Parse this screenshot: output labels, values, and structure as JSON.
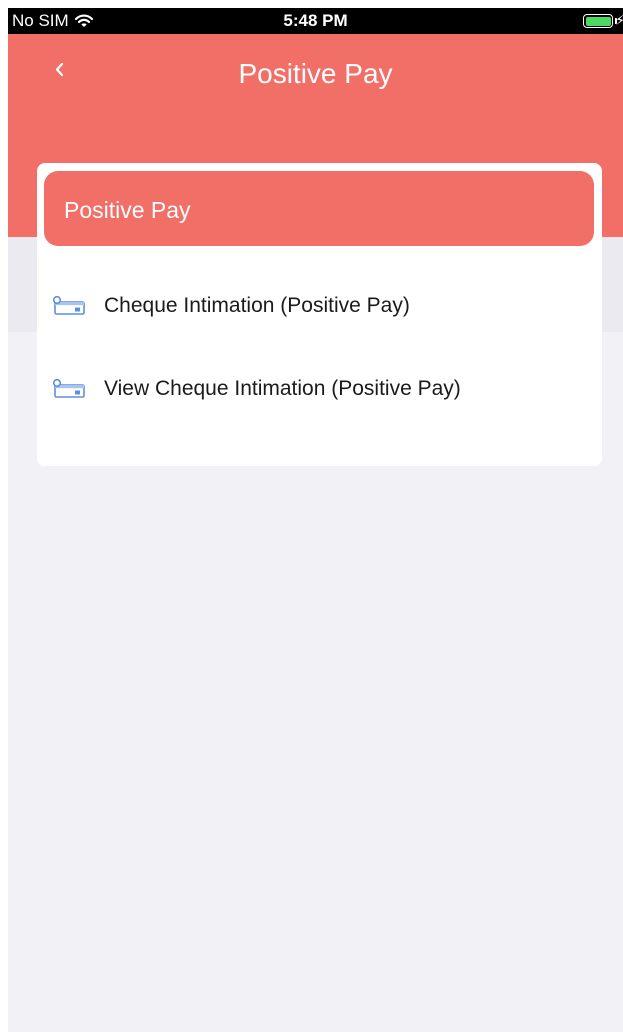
{
  "status_bar": {
    "carrier": "No SIM",
    "time": "5:48 PM",
    "battery_icon": "battery-charging-icon",
    "wifi_icon": "wifi-icon"
  },
  "header": {
    "title": "Positive Pay",
    "back_icon": "chevron-left-icon"
  },
  "card": {
    "section_title": "Positive Pay",
    "items": [
      {
        "label": "Cheque Intimation (Positive Pay)",
        "icon": "cheque-icon"
      },
      {
        "label": "View Cheque Intimation (Positive Pay)",
        "icon": "cheque-icon"
      }
    ]
  },
  "colors": {
    "accent": "#f16f66",
    "background": "#f2f1f6",
    "icon_blue": "#5b8fe0"
  }
}
